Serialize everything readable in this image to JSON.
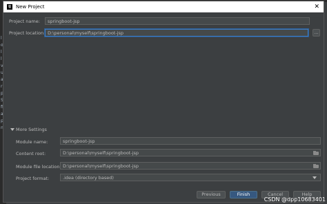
{
  "window": {
    "title": "New Project",
    "app_icon_glyph": "IJ"
  },
  "form": {
    "project_name": {
      "label": "Project name:",
      "value": "springboot-jsp"
    },
    "project_location": {
      "label": "Project location:",
      "value": "D:\\personal\\myself\\springboot-jsp",
      "browse_label": "..."
    }
  },
  "more_settings": {
    "toggle_label": "More Settings",
    "module_name": {
      "label": "Module name:",
      "value": "springboot-jsp"
    },
    "content_root": {
      "label": "Content root:",
      "value": "D:\\personal\\myself\\springboot-jsp"
    },
    "module_file_location": {
      "label": "Module file location:",
      "value": "D:\\personal\\myself\\springboot-jsp"
    },
    "project_format": {
      "label": "Project format:",
      "value": ".idea (directory based)"
    }
  },
  "buttons": {
    "previous": "Previous",
    "finish": "Finish",
    "cancel": "Cancel",
    "help": "Help"
  },
  "background_text": [
    "l",
    "o",
    "l",
    "l",
    "v",
    "u",
    "a",
    "r",
    "p",
    "S",
    "fi",
    "a",
    "p",
    "n"
  ],
  "watermark": "CSDN @dpp10683401",
  "colors": {
    "accent": "#3d7dc6",
    "primary_button": "#365880",
    "dialog_bg": "#3c3f41"
  }
}
